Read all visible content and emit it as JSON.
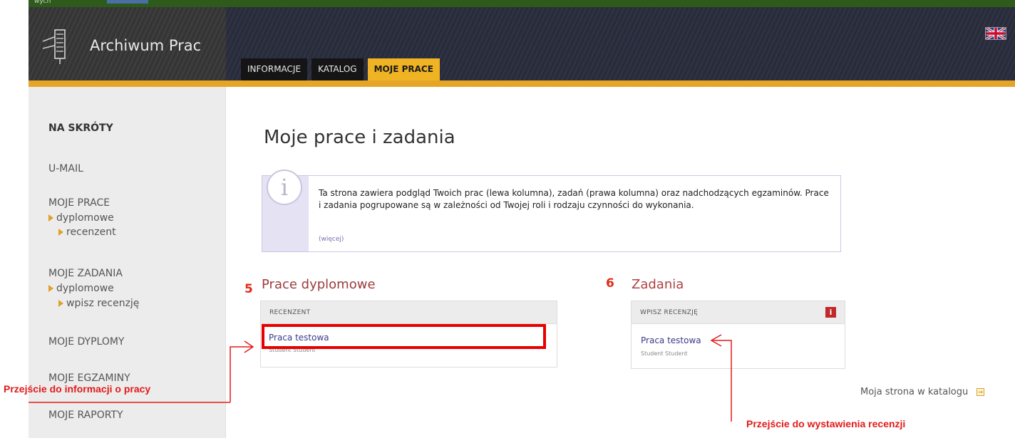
{
  "topbar": {
    "crumb": "wych"
  },
  "header": {
    "logo_text": "Archiwum Prac",
    "tabs": [
      {
        "label": "INFORMACJE",
        "active": false
      },
      {
        "label": "KATALOG",
        "active": false
      },
      {
        "label": "MOJE PRACE",
        "active": true
      }
    ],
    "language_icon": "uk-flag-icon"
  },
  "sidebar": {
    "shortcuts": "NA SKRÓTY",
    "umail": "U-MAIL",
    "moje_prace": {
      "label": "MOJE PRACE",
      "sub": "dyplomowe",
      "subsub": "recenzent"
    },
    "moje_zadania": {
      "label": "MOJE ZADANIA",
      "sub": "dyplomowe",
      "subsub": "wpisz recenzję"
    },
    "moje_dyplomy": "MOJE DYPLOMY",
    "moje_egzaminy": "MOJE EGZAMINY",
    "moje_raporty": "MOJE RAPORTY"
  },
  "main": {
    "title": "Moje prace i zadania",
    "info": {
      "icon": "info-icon",
      "text": "Ta strona zawiera podgląd Twoich prac (lewa kolumna), zadań (prawa kolumna) oraz nadchodzących egzaminów. Prace i zadania pogrupowane są w zależności od Twojej roli i rodzaju czynności do wykonania.",
      "more": "(więcej)"
    },
    "left": {
      "number": "5",
      "title": "Prace dyplomowe",
      "head": "RECENZENT",
      "link": "Praca testowa",
      "author": "Student Student"
    },
    "right": {
      "number": "6",
      "title": "Zadania",
      "head": "WPISZ RECENZJĘ",
      "link": "Praca testowa",
      "author": "Student Student"
    },
    "katalog_link": "Moja strona w katalogu"
  },
  "annotations": {
    "left": "Przejście do informacji o pracy",
    "right": "Przejście do wystawienia recenzji"
  },
  "colors": {
    "accent": "#f0b323",
    "annotation": "#e31a1a",
    "header": "#2f3242"
  }
}
